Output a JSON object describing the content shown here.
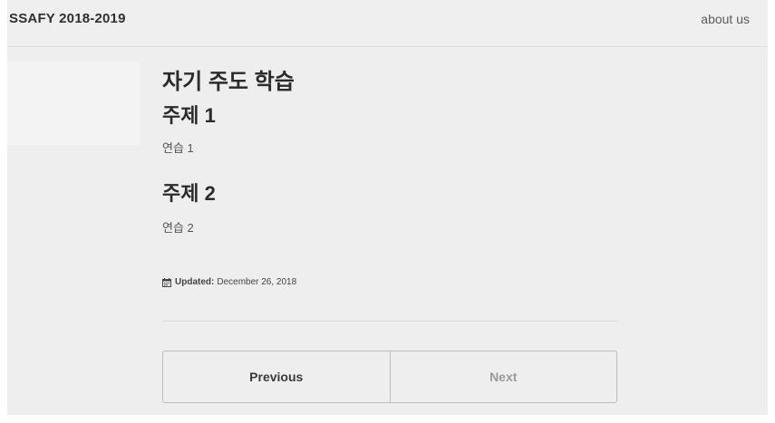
{
  "masthead": {
    "site_title": "SSAFY 2018-2019",
    "nav": {
      "about_label": "about us"
    }
  },
  "content": {
    "page_title": "자기 주도 학습",
    "sections": [
      {
        "heading": "주제 1",
        "text": "연습 1"
      },
      {
        "heading": "주제 2",
        "text": "연습 2"
      }
    ],
    "updated": {
      "icon": "calendar-icon",
      "label": "Updated:",
      "date": "December 26, 2018"
    }
  },
  "pager": {
    "previous_label": "Previous",
    "next_label": "Next"
  },
  "colors": {
    "background": "#eeeeee",
    "text": "#3a3a3a",
    "muted": "#9a9a9a",
    "border": "#bdbdbd"
  }
}
